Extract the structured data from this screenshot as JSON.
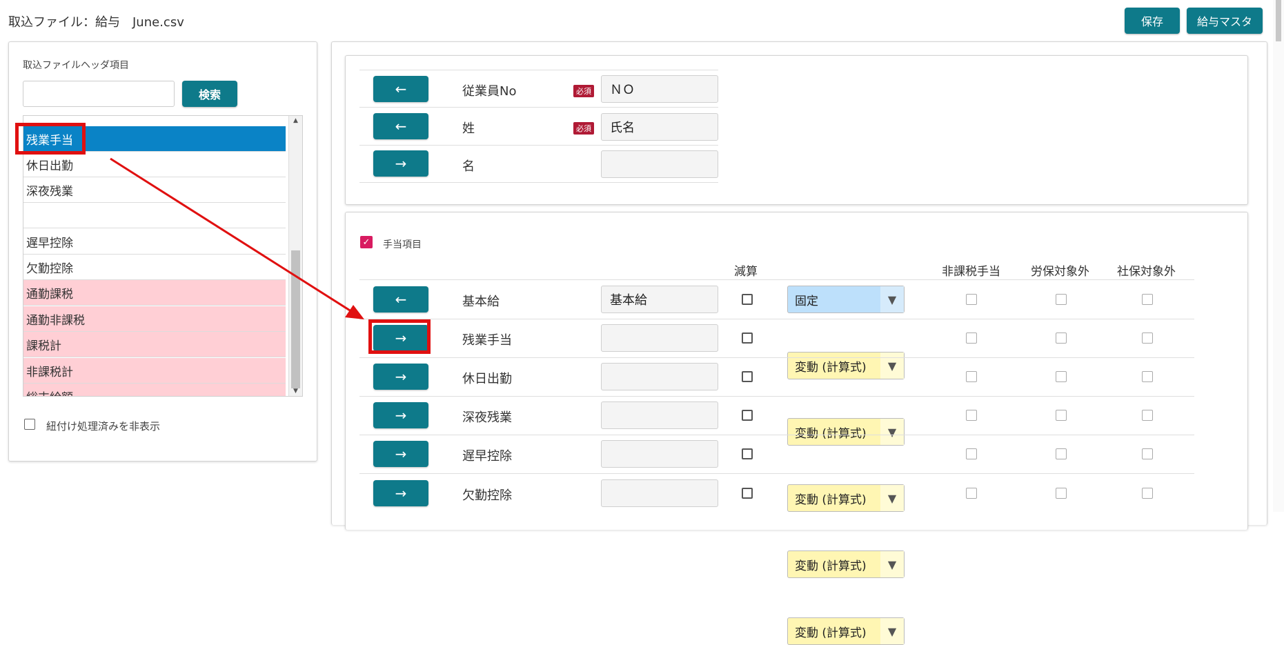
{
  "header": {
    "title": "取込ファイル：給与　June.csv",
    "save_label": "保存",
    "master_label": "給与マスタ"
  },
  "left_panel": {
    "header_label": "取込ファイルヘッダ項目",
    "search_placeholder": "",
    "search_button": "検索",
    "list_items": [
      {
        "label": "残業手当",
        "state": "selected"
      },
      {
        "label": "休日出勤",
        "state": "normal"
      },
      {
        "label": "深夜残業",
        "state": "normal"
      },
      {
        "label": "",
        "state": "normal"
      },
      {
        "label": "遅早控除",
        "state": "normal"
      },
      {
        "label": "欠勤控除",
        "state": "normal"
      },
      {
        "label": "通勤課税",
        "state": "pink"
      },
      {
        "label": "通勤非課税",
        "state": "pink"
      },
      {
        "label": "課税計",
        "state": "pink"
      },
      {
        "label": "非課税計",
        "state": "pink"
      },
      {
        "label": "総支給額",
        "state": "pink"
      }
    ],
    "hide_processed_label": "紐付け処理済みを非表示"
  },
  "top_mapping": {
    "rows": [
      {
        "arrow": "←",
        "label": "従業員No",
        "required": "必須",
        "value": "ＮＯ"
      },
      {
        "arrow": "←",
        "label": "姓",
        "required": "必須",
        "value": "氏名"
      },
      {
        "arrow": "→",
        "label": "名",
        "required": "",
        "value": ""
      }
    ]
  },
  "allowance": {
    "section_label": "手当項目",
    "section_checked": true,
    "columns": {
      "subtract": "減算",
      "non_taxable": "非課税手当",
      "labor_ins_excluded": "労保対象外",
      "social_ins_excluded": "社保対象外"
    },
    "rows": [
      {
        "arrow": "←",
        "label": "基本給",
        "value": "基本給",
        "type": "固定",
        "type_style": "fixed"
      },
      {
        "arrow": "→",
        "label": "残業手当",
        "value": "",
        "type": "変動 (計算式)",
        "type_style": "variable"
      },
      {
        "arrow": "→",
        "label": "休日出勤",
        "value": "",
        "type": "変動 (計算式)",
        "type_style": "variable"
      },
      {
        "arrow": "→",
        "label": "深夜残業",
        "value": "",
        "type": "変動 (計算式)",
        "type_style": "variable"
      },
      {
        "arrow": "→",
        "label": "遅早控除",
        "value": "",
        "type": "変動 (計算式)",
        "type_style": "variable"
      },
      {
        "arrow": "→",
        "label": "欠勤控除",
        "value": "",
        "type": "変動 (計算式)",
        "type_style": "variable"
      }
    ]
  },
  "icons": {
    "dropdown": "▼",
    "scroll_up": "▲",
    "scroll_down": "▼"
  },
  "colors": {
    "primary": "#0e7a8a",
    "selected_row": "#0a83c6",
    "pink_row": "#ffcfd5",
    "required_badge": "#b01a35",
    "annotation": "#e01010",
    "fixed_select": "#bde0fb",
    "variable_select": "#fff6b3"
  }
}
